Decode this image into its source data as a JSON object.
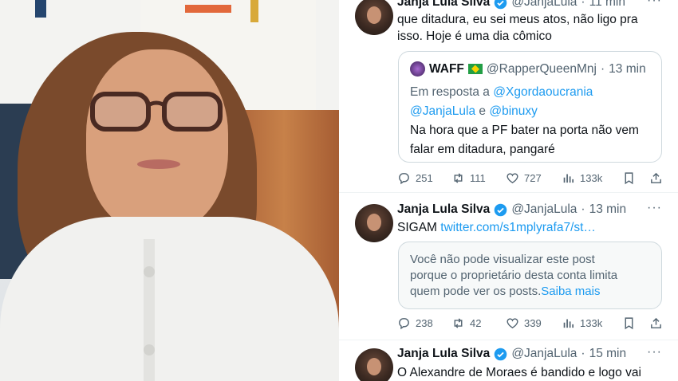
{
  "tweets": [
    {
      "name": "Janja Lula Silva",
      "handle": "@JanjaLula",
      "time": "11 min",
      "text_line1": "que ditadura, eu sei meus atos, não ligo pra",
      "text_line2": "isso. Hoje é uma dia cômico",
      "quote": {
        "name": "WAFF",
        "handle": "@RapperQueenMnj",
        "time": "13 min",
        "reply_prefix": "Em resposta a",
        "mention1": "@Xgordaoucrania",
        "mention2": "@JanjaLula",
        "conj": "e",
        "mention3": "@binuxy",
        "text_line1": "Na hora que a PF bater na porta não vem",
        "text_line2": "falar em ditadura, pangaré"
      },
      "replies": "251",
      "retweets": "111",
      "likes": "727",
      "views": "133k"
    },
    {
      "name": "Janja Lula Silva",
      "handle": "@JanjaLula",
      "time": "13 min",
      "text_prefix": "SIGAM",
      "link": "twitter.com/s1mplyrafa7/st…",
      "notice_line1": "Você não pode visualizar este post",
      "notice_line2": "porque o proprietário desta conta limita",
      "notice_line3": "quem pode ver os posts.",
      "notice_link": "Saiba mais",
      "replies": "238",
      "retweets": "42",
      "likes": "339",
      "views": "133k"
    },
    {
      "name": "Janja Lula Silva",
      "handle": "@JanjaLula",
      "time": "15 min",
      "text_line1": "O Alexandre de Moraes é bandido e logo vai"
    }
  ],
  "icons": {
    "verified": "verified-badge-icon",
    "reply": "reply-icon",
    "retweet": "retweet-icon",
    "like": "heart-icon",
    "views": "views-icon",
    "bookmark": "bookmark-icon",
    "share": "share-icon",
    "more": "more-icon"
  },
  "colors": {
    "accent": "#1d9bf0",
    "muted": "#536471",
    "text": "#0f1419",
    "border": "#cfd9de"
  }
}
